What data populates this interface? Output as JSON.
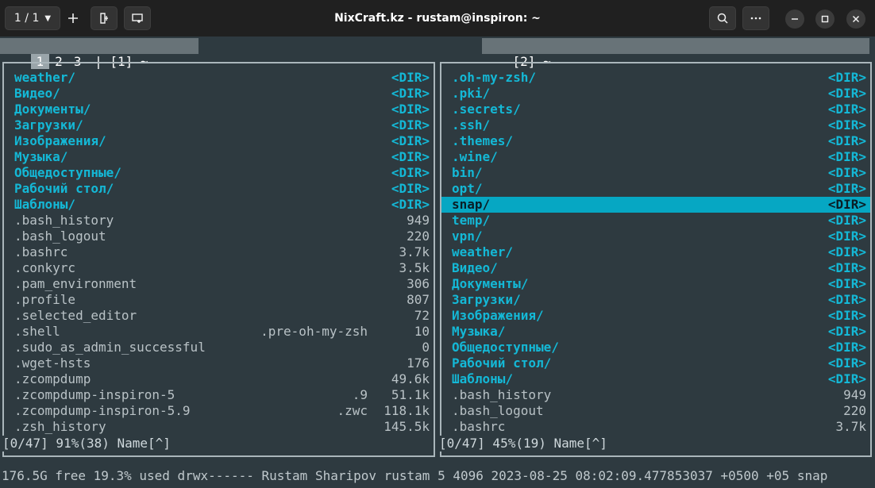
{
  "window": {
    "title": "NixCraft.kz - rustam@inspiron: ~",
    "tab_counter": "1 / 1",
    "caret_icon": "chevron-down-icon",
    "buttons": [
      "new-tab-icon",
      "split-icon",
      "new-window-icon",
      "search-icon",
      "menu-icon",
      "minimize-icon",
      "maximize-icon",
      "close-icon"
    ]
  },
  "tabs": {
    "numbers": [
      "1",
      "2",
      "3"
    ],
    "active": "1",
    "left_label": "| [1] ~",
    "right_label": "[2] ~"
  },
  "left_panel": {
    "entries": [
      {
        "name": "weather/",
        "size": "<DIR>",
        "type": "dir"
      },
      {
        "name": "Видео/",
        "size": "<DIR>",
        "type": "dir"
      },
      {
        "name": "Документы/",
        "size": "<DIR>",
        "type": "dir"
      },
      {
        "name": "Загрузки/",
        "size": "<DIR>",
        "type": "dir"
      },
      {
        "name": "Изображения/",
        "size": "<DIR>",
        "type": "dir"
      },
      {
        "name": "Музыка/",
        "size": "<DIR>",
        "type": "dir"
      },
      {
        "name": "Общедоступные/",
        "size": "<DIR>",
        "type": "dir"
      },
      {
        "name": "Рабочий стол/",
        "size": "<DIR>",
        "type": "dir"
      },
      {
        "name": "Шаблоны/",
        "size": "<DIR>",
        "type": "dir"
      },
      {
        "name": ".bash_history",
        "size": "949",
        "type": "file"
      },
      {
        "name": ".bash_logout",
        "size": "220",
        "type": "file"
      },
      {
        "name": ".bashrc",
        "size": "3.7k",
        "type": "file"
      },
      {
        "name": ".conkyrc",
        "size": "3.5k",
        "type": "file"
      },
      {
        "name": ".pam_environment",
        "size": "306",
        "type": "file"
      },
      {
        "name": ".profile",
        "size": "807",
        "type": "file"
      },
      {
        "name": ".selected_editor",
        "size": "72",
        "type": "file"
      },
      {
        "name": ".shell",
        "ext": ".pre-oh-my-zsh",
        "size": "10",
        "type": "file"
      },
      {
        "name": ".sudo_as_admin_successful",
        "size": "0",
        "type": "file"
      },
      {
        "name": ".wget-hsts",
        "size": "176",
        "type": "file"
      },
      {
        "name": ".zcompdump",
        "size": "49.6k",
        "type": "file"
      },
      {
        "name": ".zcompdump-inspiron-5",
        "ext": ".9",
        "size": "51.1k",
        "type": "file"
      },
      {
        "name": ".zcompdump-inspiron-5.9",
        "ext": ".zwc",
        "size": "118.1k",
        "type": "file"
      },
      {
        "name": ".zsh_history",
        "size": "145.5k",
        "type": "file"
      }
    ],
    "status": "[0/47] 91%(38) Name[^]"
  },
  "right_panel": {
    "selected_index": 8,
    "entries": [
      {
        "name": ".oh-my-zsh/",
        "size": "<DIR>",
        "type": "dir"
      },
      {
        "name": ".pki/",
        "size": "<DIR>",
        "type": "dir"
      },
      {
        "name": ".secrets/",
        "size": "<DIR>",
        "type": "dir"
      },
      {
        "name": ".ssh/",
        "size": "<DIR>",
        "type": "dir"
      },
      {
        "name": ".themes/",
        "size": "<DIR>",
        "type": "dir"
      },
      {
        "name": ".wine/",
        "size": "<DIR>",
        "type": "dir"
      },
      {
        "name": "bin/",
        "size": "<DIR>",
        "type": "dir"
      },
      {
        "name": "opt/",
        "size": "<DIR>",
        "type": "dir"
      },
      {
        "name": "snap/",
        "size": "<DIR>",
        "type": "dir"
      },
      {
        "name": "temp/",
        "size": "<DIR>",
        "type": "dir"
      },
      {
        "name": "vpn/",
        "size": "<DIR>",
        "type": "dir"
      },
      {
        "name": "weather/",
        "size": "<DIR>",
        "type": "dir"
      },
      {
        "name": "Видео/",
        "size": "<DIR>",
        "type": "dir"
      },
      {
        "name": "Документы/",
        "size": "<DIR>",
        "type": "dir"
      },
      {
        "name": "Загрузки/",
        "size": "<DIR>",
        "type": "dir"
      },
      {
        "name": "Изображения/",
        "size": "<DIR>",
        "type": "dir"
      },
      {
        "name": "Музыка/",
        "size": "<DIR>",
        "type": "dir"
      },
      {
        "name": "Общедоступные/",
        "size": "<DIR>",
        "type": "dir"
      },
      {
        "name": "Рабочий стол/",
        "size": "<DIR>",
        "type": "dir"
      },
      {
        "name": "Шаблоны/",
        "size": "<DIR>",
        "type": "dir"
      },
      {
        "name": ".bash_history",
        "size": "949",
        "type": "file"
      },
      {
        "name": ".bash_logout",
        "size": "220",
        "type": "file"
      },
      {
        "name": ".bashrc",
        "size": "3.7k",
        "type": "file"
      }
    ],
    "status": "[0/47] 45%(19) Name[^]"
  },
  "statusbar": "176.5G free 19.3% used drwx------ Rustam Sharipov rustam 5 4096 2023-08-25 08:02:09.477853037 +0500 +05 snap",
  "colors": {
    "background": "#2e3a40",
    "titlebar": "#202020",
    "dir_text": "#14b8d6",
    "file_text": "#b9c2c6",
    "selection": "#06a7c3",
    "border": "#aab6bb"
  }
}
